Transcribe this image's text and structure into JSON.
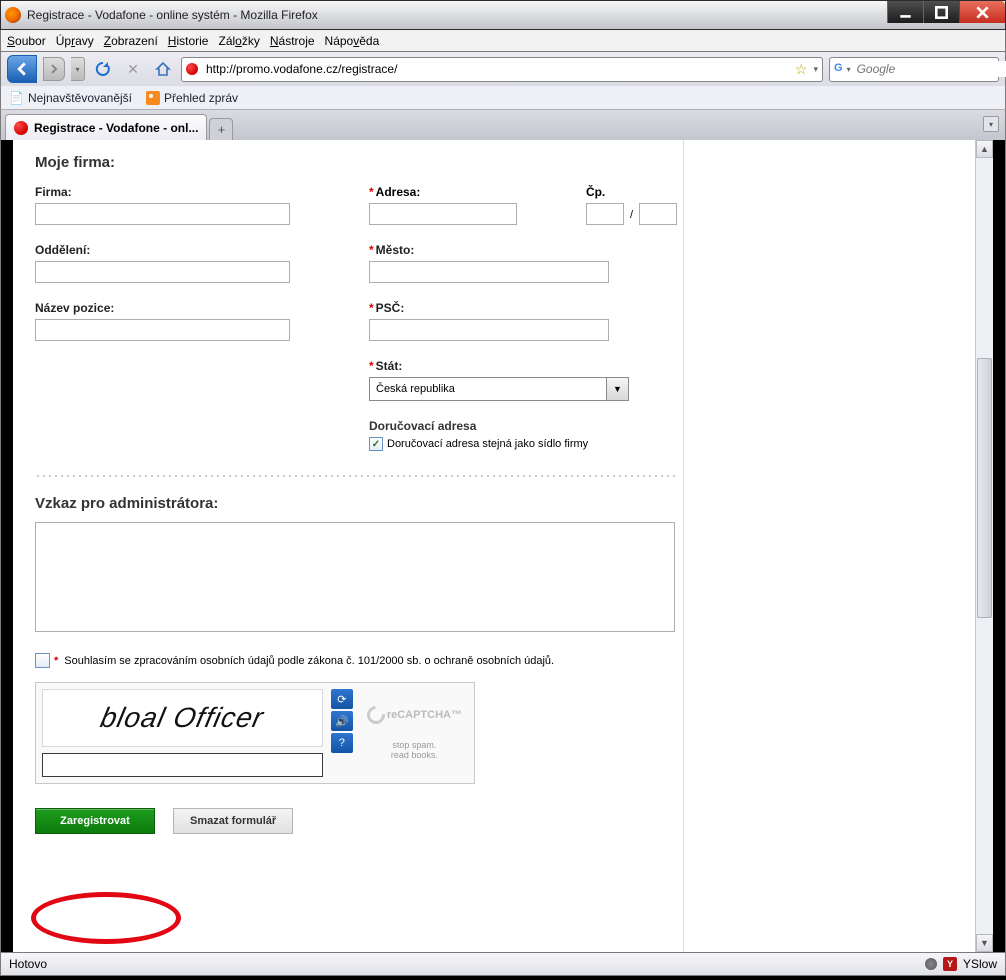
{
  "window": {
    "title": "Registrace - Vodafone - online systém - Mozilla Firefox"
  },
  "menu": {
    "soubor": "Soubor",
    "upravy": "Úpravy",
    "zobrazeni": "Zobrazení",
    "historie": "Historie",
    "zalozky": "Záložky",
    "nastroje": "Nástroje",
    "napoveda": "Nápověda"
  },
  "nav": {
    "url": "http://promo.vodafone.cz/registrace/",
    "search_placeholder": "Google"
  },
  "bookmarks": {
    "most_visited": "Nejnavštěvovanější",
    "news": "Přehled zpráv"
  },
  "tab": {
    "title": "Registrace - Vodafone - onl..."
  },
  "form": {
    "section_title": "Moje firma:",
    "firma_label": "Firma:",
    "oddeleni_label": "Oddělení:",
    "pozice_label": "Název pozice:",
    "adresa_label": "Adresa:",
    "cp_label": "Čp.",
    "mesto_label": "Město:",
    "psc_label": "PSČ:",
    "stat_label": "Stát:",
    "stat_value": "Česká republika",
    "doruc_heading": "Doručovací adresa",
    "doruc_same": "Doručovací adresa stejná jako sídlo firmy"
  },
  "message": {
    "title": "Vzkaz pro administrátora:"
  },
  "consent": {
    "text": "Souhlasím se zpracováním osobních údajů podle zákona č. 101/2000 sb. o ochraně osobních údajů."
  },
  "captcha": {
    "text": "bloal   Officer",
    "brand": "reCAPTCHA™",
    "line1": "stop spam.",
    "line2": "read books."
  },
  "buttons": {
    "register": "Zaregistrovat",
    "reset": "Smazat formulář"
  },
  "status": {
    "left": "Hotovo",
    "right": "YSlow"
  }
}
